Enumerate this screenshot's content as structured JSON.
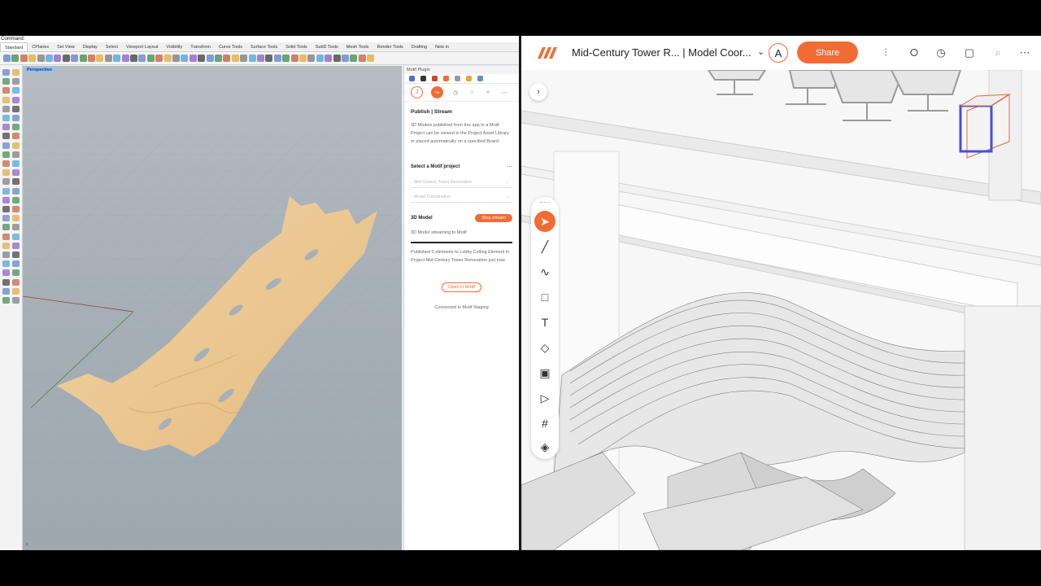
{
  "rhino": {
    "command_label": "Command:",
    "tabs": [
      "Standard",
      "CPlanes",
      "Set View",
      "Display",
      "Select",
      "Viewport Layout",
      "Visibility",
      "Transform",
      "Curve Tools",
      "Surface Tools",
      "Solid Tools",
      "SubD Tools",
      "Mesh Tools",
      "Render Tools",
      "Drafting",
      "New in"
    ],
    "viewport_label": "Perspective",
    "axes_label": "z"
  },
  "plugin": {
    "header": "Motif Plugin",
    "avatar_initial": "J",
    "section_title": "Publish | Stream",
    "description": "3D Models published from this app to a Motif Project can be viewed in the Project Asset Library or placed automatically on a specified Board.",
    "select_label": "Select a Motif project",
    "project_value": "Mid-Century Tower Renovation",
    "board_value": "Model Coordination",
    "model_label": "3D Model",
    "stop_label": "Stop stream",
    "streaming_text": "3D Model streaming to Motif",
    "published_text": "Published 0 elements to Lobby Ceiling Element in Project Mid-Century Tower Renovation just now",
    "open_label": "Open in Motif",
    "connected_text": "Connected to Motif Staging"
  },
  "motif": {
    "title": "Mid-Century Tower R...  |  Model Coor...",
    "avatar_initial": "A",
    "share_label": "Share",
    "icons": [
      "sliders-icon",
      "share-nodes-icon",
      "history-icon",
      "comment-icon",
      "search-icon",
      "more-icon"
    ]
  },
  "colors": {
    "accent": "#f26b35",
    "wood": "#eecb96",
    "viewport": "#a7b0b7"
  }
}
